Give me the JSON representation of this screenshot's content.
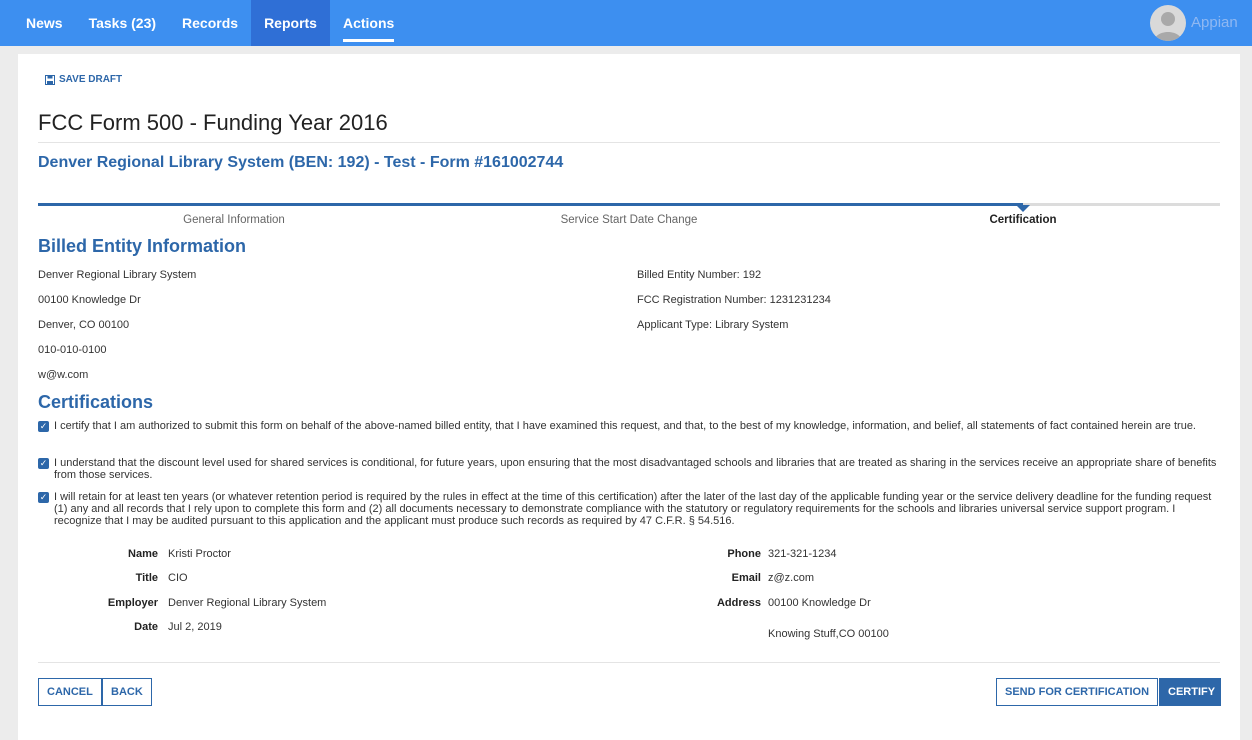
{
  "nav": {
    "items": [
      "News",
      "Tasks (23)",
      "Records",
      "Reports",
      "Actions"
    ],
    "brand": "Appian"
  },
  "save_draft": "SAVE DRAFT",
  "page_title": "FCC Form 500 - Funding Year 2016",
  "subtitle": "Denver Regional Library System (BEN: 192) - Test - Form #161002744",
  "steps": [
    "General Information",
    "Service Start Date Change",
    "Certification"
  ],
  "billed_entity": {
    "heading": "Billed Entity Information",
    "left": [
      "Denver Regional Library System",
      "00100 Knowledge Dr",
      "Denver, CO 00100",
      "010-010-0100",
      "w@w.com"
    ],
    "right": [
      "Billed Entity Number: 192",
      "FCC Registration Number: 1231231234",
      "Applicant Type: Library System"
    ]
  },
  "certifications": {
    "heading": "Certifications",
    "items": [
      "I certify that I am authorized to submit this form on behalf of the above-named billed entity, that I have examined this request, and that, to the best of my knowledge, information, and belief, all statements of fact contained herein are true.",
      "I understand that the discount level used for shared services is conditional, for future years, upon ensuring that the most disadvantaged schools and libraries that are treated as sharing in the services receive an appropriate share of benefits from those services.",
      "I will retain for at least ten years (or whatever retention period is required by the rules in effect at the time of this certification) after the later of the last day of the applicable funding year or the service delivery deadline for the funding request (1) any and all records that I rely upon to complete this form and (2) all documents necessary to demonstrate compliance with the statutory or regulatory requirements for the schools and libraries universal service support program. I recognize that I may be audited pursuant to this application and the applicant must produce such records as required by 47 C.F.R. § 54.516."
    ]
  },
  "certifier": {
    "name_label": "Name",
    "name": "Kristi Proctor",
    "title_label": "Title",
    "title": "CIO",
    "employer_label": "Employer",
    "employer": "Denver Regional Library System",
    "date_label": "Date",
    "date": "Jul 2, 2019",
    "phone_label": "Phone",
    "phone": "321-321-1234",
    "email_label": "Email",
    "email": "z@z.com",
    "address_label": "Address",
    "address1": "00100 Knowledge Dr",
    "address2": "Knowing Stuff,CO 00100"
  },
  "buttons": {
    "cancel": "CANCEL",
    "back": "BACK",
    "send": "SEND FOR CERTIFICATION",
    "certify": "CERTIFY"
  },
  "colors": {
    "nav_bg": "#3d8ff0",
    "accent": "#2d67a9"
  }
}
